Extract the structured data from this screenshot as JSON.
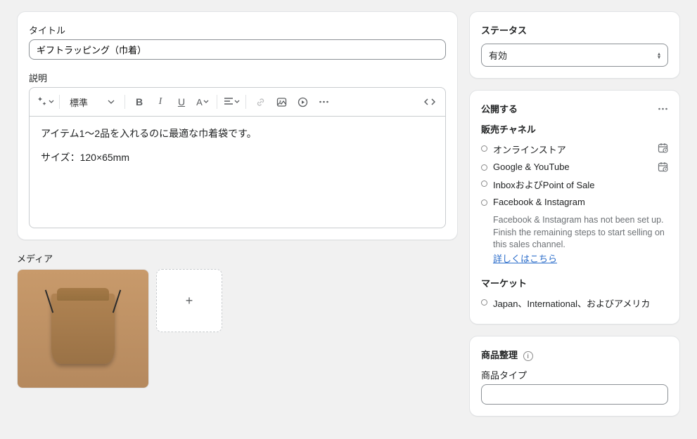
{
  "main": {
    "title_label": "タイトル",
    "title_value": "ギフトラッピング（巾着）",
    "description_label": "説明",
    "toolbar_format": "標準",
    "desc_line1": "アイテム1〜2品を入れるのに最適な巾着袋です。",
    "desc_line2": "サイズ：120×65mm",
    "media_label": "メディア"
  },
  "status": {
    "heading": "ステータス",
    "value": "有効"
  },
  "publish": {
    "heading": "公開する",
    "channels_heading": "販売チャネル",
    "channels": [
      {
        "name": "オンラインストア",
        "has_cal": true
      },
      {
        "name": "Google & YouTube",
        "has_cal": true
      },
      {
        "name": "InboxおよびPoint of Sale",
        "has_cal": false
      },
      {
        "name": "Facebook & Instagram",
        "has_cal": false
      }
    ],
    "fb_note": "Facebook & Instagram has not been set up. Finish the remaining steps to start selling on this sales channel.",
    "fb_link": "詳しくはこちら",
    "markets_heading": "マーケット",
    "markets_value": "Japan、International、およびアメリカ"
  },
  "organize": {
    "heading": "商品整理",
    "type_label": "商品タイプ",
    "type_value": ""
  }
}
